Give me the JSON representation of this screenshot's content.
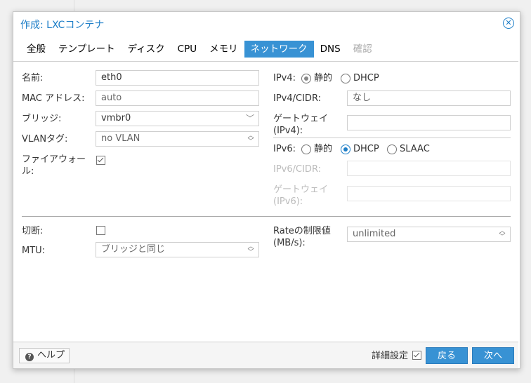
{
  "dialog": {
    "title": "作成: LXCコンテナ"
  },
  "tabs": [
    "全般",
    "テンプレート",
    "ディスク",
    "CPU",
    "メモリ",
    "ネットワーク",
    "DNS",
    "確認"
  ],
  "left": {
    "name_label": "名前:",
    "name_value": "eth0",
    "mac_label": "MAC アドレス:",
    "mac_value": "auto",
    "bridge_label": "ブリッジ:",
    "bridge_value": "vmbr0",
    "vlan_label": "VLANタグ:",
    "vlan_value": "no VLAN",
    "firewall_label_1": "ファイアウォー",
    "firewall_label_2": "ル:",
    "firewall_checked": true
  },
  "right": {
    "ipv4_label": "IPv4:",
    "ipv4_static": "静的",
    "ipv4_dhcp": "DHCP",
    "ipv4cidr_label": "IPv4/CIDR:",
    "ipv4cidr_value": "なし",
    "gw4_label_1": "ゲートウェイ",
    "gw4_label_2": "(IPv4):",
    "ipv6_label": "IPv6:",
    "ipv6_static": "静的",
    "ipv6_dhcp": "DHCP",
    "ipv6_slaac": "SLAAC",
    "ipv6cidr_label": "IPv6/CIDR:",
    "gw6_label_1": "ゲートウェイ",
    "gw6_label_2": "(IPv6):"
  },
  "advanced": {
    "disconnect_label": "切断:",
    "mtu_label": "MTU:",
    "mtu_value": "ブリッジと同じ",
    "rate_label_1": "Rateの制限値",
    "rate_label_2": "(MB/s):",
    "rate_value": "unlimited"
  },
  "footer": {
    "help": "ヘルプ",
    "advanced_label": "詳細設定",
    "advanced_checked": true,
    "back": "戻る",
    "next": "次へ"
  },
  "colors": {
    "accent": "#3892d4",
    "title": "#1f7fc8"
  }
}
